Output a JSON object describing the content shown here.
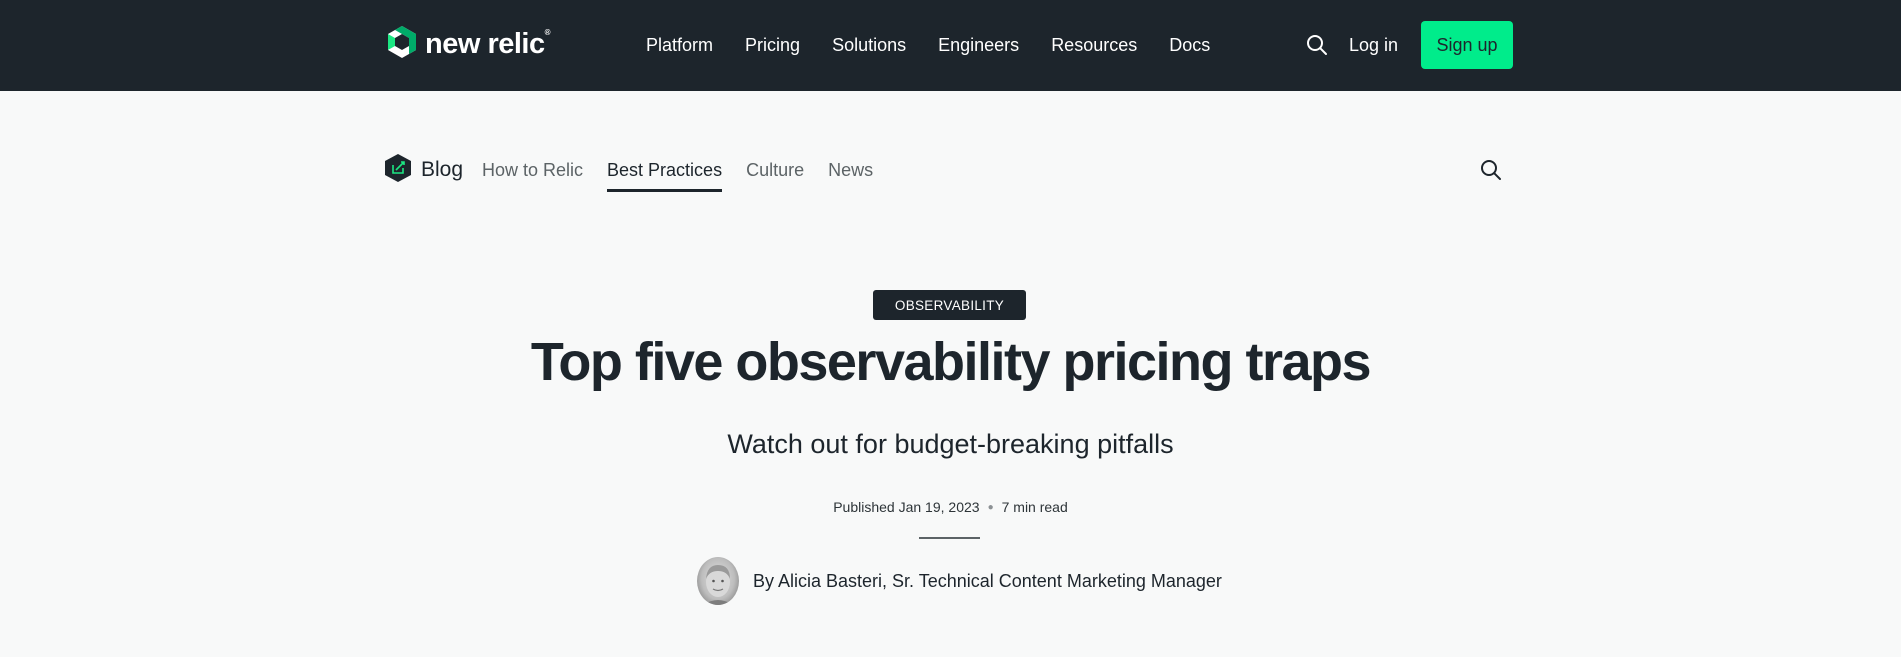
{
  "header": {
    "logo_text": "new relic",
    "logo_mark": "®",
    "nav": [
      "Platform",
      "Pricing",
      "Solutions",
      "Engineers",
      "Resources",
      "Docs"
    ],
    "login_label": "Log in",
    "signup_label": "Sign up",
    "signup_color": "#00ec8b",
    "background_color": "#1d252c"
  },
  "blog_nav": {
    "logo_label": "Blog",
    "items": [
      {
        "label": "How to Relic",
        "active": false
      },
      {
        "label": "Best Practices",
        "active": true
      },
      {
        "label": "Culture",
        "active": false
      },
      {
        "label": "News",
        "active": false
      }
    ]
  },
  "article": {
    "tag": "OBSERVABILITY",
    "title": "Top five observability pricing traps",
    "subtitle": "Watch out for budget-breaking pitfalls",
    "published": "Published Jan 19, 2023",
    "read_time": "7 min read",
    "author": "By Alicia Basteri, Sr. Technical Content Marketing Manager"
  },
  "icons": {
    "logo": "new-relic-logo-icon",
    "search": "search-icon",
    "blog": "blog-hexagon-icon",
    "avatar": "author-avatar"
  }
}
